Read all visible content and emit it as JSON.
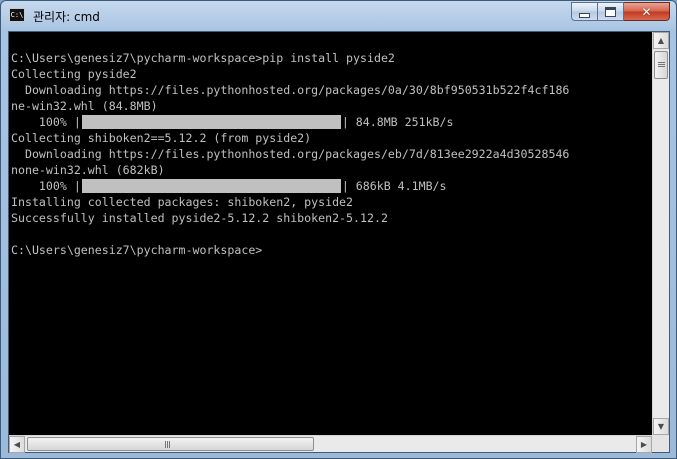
{
  "window": {
    "title": "관리자: cmd",
    "app_icon_text": "C:\\",
    "minimize_glyph": "",
    "close_glyph": "✕"
  },
  "console": {
    "lines": [
      "C:\\Users\\genesiz7\\pycharm-workspace>pip install pyside2",
      "Collecting pyside2",
      "  Downloading https://files.pythonhosted.org/packages/0a/30/8bf950531b522f4cf186",
      "ne-win32.whl (84.8MB)",
      {
        "prefix": "    100% |",
        "bar_fraction": 1.0,
        "suffix": "| 84.8MB 251kB/s"
      },
      "Collecting shiboken2==5.12.2 (from pyside2)",
      "  Downloading https://files.pythonhosted.org/packages/eb/7d/813ee2922a4d30528546",
      "none-win32.whl (682kB)",
      {
        "prefix": "    100% |",
        "bar_fraction": 1.0,
        "suffix": "| 686kB 4.1MB/s"
      },
      "Installing collected packages: shiboken2, pyside2",
      "Successfully installed pyside2-5.12.2 shiboken2-5.12.2",
      "",
      "C:\\Users\\genesiz7\\pycharm-workspace>"
    ]
  },
  "scrollbars": {
    "up_arrow": "▲",
    "down_arrow": "▼",
    "left_arrow": "◀",
    "right_arrow": "▶",
    "h_thumb_grip": "|||"
  }
}
